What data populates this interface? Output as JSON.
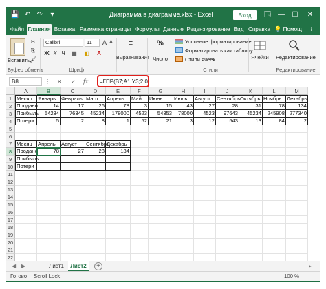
{
  "titlebar": {
    "title": "Диаграмма в диаграмме.xlsx - Excel",
    "signin_label": "Вход",
    "quick_access": [
      "💾",
      "↶",
      "↷",
      "▾"
    ],
    "window_controls": [
      "🗔",
      "—",
      "☐",
      "✕"
    ],
    "brand_color": "#217346"
  },
  "ribbon": {
    "tabs": [
      {
        "label": "Файл"
      },
      {
        "label": "Главная"
      },
      {
        "label": "Вставка"
      },
      {
        "label": "Разметка страницы"
      },
      {
        "label": "Формулы"
      },
      {
        "label": "Данные"
      },
      {
        "label": "Рецензирование"
      },
      {
        "label": "Вид"
      },
      {
        "label": "Справка"
      },
      {
        "label": "Помощ"
      }
    ],
    "active_tab": "Главная",
    "share_icon": "⇪",
    "font": {
      "name": "Calibri",
      "size": "11"
    },
    "groups": {
      "clipboard": "Буфер обмена",
      "font": "Шрифт",
      "alignment": "Выравнивание",
      "number": "Число",
      "styles": "Стили",
      "editing": "Редактирование"
    },
    "paste_label": "Вставить",
    "number_percent": "%",
    "style_items": [
      "Условное форматирование",
      "Форматировать как таблицу",
      "Стили ячеек"
    ],
    "cells_label": "Ячейки",
    "editing_label": "Редактирование"
  },
  "formula_bar": {
    "name_box": "B8",
    "fx": "fx",
    "formula": "=ГПР(B7;A1:Y3;2;0)"
  },
  "grid": {
    "columns": [
      "A",
      "B",
      "C",
      "D",
      "E",
      "F",
      "G",
      "H",
      "I",
      "J",
      "K",
      "L",
      "M"
    ],
    "selected_column": "B",
    "selected_row": 8,
    "rows": [
      [
        "Месяц",
        "Январь",
        "Февраль",
        "Март",
        "Апрель",
        "Май",
        "Июнь",
        "Июль",
        "Август",
        "Сентябрь",
        "Октябрь",
        "Ноябрь",
        "Декабрь"
      ],
      [
        "Продано",
        "14",
        "17",
        "26",
        "78",
        "3",
        "15",
        "43",
        "27",
        "28",
        "31",
        "78",
        "134"
      ],
      [
        "Прибыль",
        "54234",
        "76345",
        "45234",
        "178000",
        "4523",
        "54353",
        "78000",
        "4523",
        "97643",
        "45234",
        "245908",
        "277340"
      ],
      [
        "Потери",
        "5",
        "2",
        "8",
        "1",
        "52",
        "21",
        "3",
        "12",
        "543",
        "13",
        "84",
        "2"
      ],
      [
        "",
        "",
        "",
        "",
        "",
        "",
        "",
        "",
        "",
        "",
        "",
        "",
        ""
      ],
      [
        "",
        "",
        "",
        "",
        "",
        "",
        "",
        "",
        "",
        "",
        "",
        "",
        ""
      ],
      [
        "Месяц",
        "Апрель",
        "Август",
        "Сентябрь",
        "Декабрь",
        "",
        "",
        "",
        "",
        "",
        "",
        "",
        ""
      ],
      [
        "Продано",
        "78",
        "27",
        "28",
        "134",
        "",
        "",
        "",
        "",
        "",
        "",
        "",
        ""
      ],
      [
        "Прибыль",
        "",
        "",
        "",
        "",
        "",
        "",
        "",
        "",
        "",
        "",
        "",
        ""
      ],
      [
        "Потери",
        "",
        "",
        "",
        "",
        "",
        "",
        "",
        "",
        "",
        "",
        "",
        ""
      ],
      [
        "",
        "",
        "",
        "",
        "",
        "",
        "",
        "",
        "",
        "",
        "",
        "",
        ""
      ],
      [
        "",
        "",
        "",
        "",
        "",
        "",
        "",
        "",
        "",
        "",
        "",
        "",
        ""
      ],
      [
        "",
        "",
        "",
        "",
        "",
        "",
        "",
        "",
        "",
        "",
        "",
        "",
        ""
      ],
      [
        "",
        "",
        "",
        "",
        "",
        "",
        "",
        "",
        "",
        "",
        "",
        "",
        ""
      ],
      [
        "",
        "",
        "",
        "",
        "",
        "",
        "",
        "",
        "",
        "",
        "",
        "",
        ""
      ],
      [
        "",
        "",
        "",
        "",
        "",
        "",
        "",
        "",
        "",
        "",
        "",
        "",
        ""
      ],
      [
        "",
        "",
        "",
        "",
        "",
        "",
        "",
        "",
        "",
        "",
        "",
        "",
        ""
      ],
      [
        "",
        "",
        "",
        "",
        "",
        "",
        "",
        "",
        "",
        "",
        "",
        "",
        ""
      ],
      [
        "",
        "",
        "",
        "",
        "",
        "",
        "",
        "",
        "",
        "",
        "",
        "",
        ""
      ],
      [
        "",
        "",
        "",
        "",
        "",
        "",
        "",
        "",
        "",
        "",
        "",
        "",
        ""
      ],
      [
        "",
        "",
        "",
        "",
        "",
        "",
        "",
        "",
        "",
        "",
        "",
        "",
        ""
      ],
      [
        "",
        "",
        "",
        "",
        "",
        "",
        "",
        "",
        "",
        "",
        "",
        "",
        ""
      ]
    ]
  },
  "sheets": {
    "tabs": [
      {
        "label": "Лист1"
      },
      {
        "label": "Лист2"
      }
    ],
    "active": "Лист2",
    "add_icon": "+",
    "nav_prev": "◀",
    "nav_next": "▶"
  },
  "status": {
    "ready": "Готово",
    "scroll_lock": "Scroll Lock",
    "zoom": "100 %"
  },
  "highlight_color": "#e0201c"
}
